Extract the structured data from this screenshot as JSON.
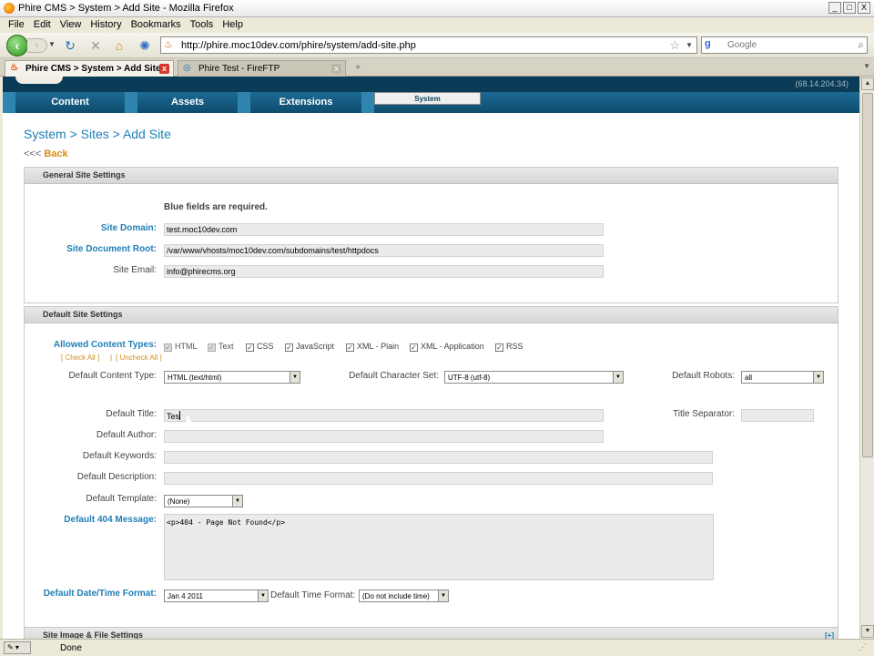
{
  "window": {
    "title": "Phire CMS > System > Add Site - Mozilla Firefox",
    "min": "_",
    "max": "□",
    "close": "X"
  },
  "menu": [
    "File",
    "Edit",
    "View",
    "History",
    "Bookmarks",
    "Tools",
    "Help"
  ],
  "toolbar": {
    "url": "http://phire.moc10dev.com/phire/system/add-site.php",
    "search_placeholder": "Google"
  },
  "tabs": [
    {
      "label": "Phire CMS > System > Add Site",
      "active": true
    },
    {
      "label": "Phire Test - FireFTP",
      "active": false
    }
  ],
  "site": {
    "header_meta": "(68.14.204.34)",
    "nav": [
      "Content",
      "Assets",
      "Extensions",
      "System"
    ]
  },
  "page": {
    "breadcrumb": "System > Sites > Add Site",
    "back_arrows": "<<<",
    "back_label": "Back"
  },
  "general": {
    "heading": "General Site Settings",
    "required_note": "Blue fields are required.",
    "site_domain_label": "Site Domain:",
    "site_domain_value": "test.moc10dev.com",
    "doc_root_label": "Site Document Root:",
    "doc_root_value": "/var/www/vhosts/moc10dev.com/subdomains/test/httpdocs",
    "email_label": "Site Email:",
    "email_value": "info@phirecms.org"
  },
  "defaults": {
    "heading": "Default Site Settings",
    "allowed_types_label": "Allowed Content Types:",
    "check_all": "[ Check All ]",
    "uncheck_all": "[ Uncheck All ]",
    "separator": "|",
    "content_types": [
      {
        "label": "HTML",
        "checked": true,
        "disabled": true
      },
      {
        "label": "Text",
        "checked": true,
        "disabled": true
      },
      {
        "label": "CSS",
        "checked": true,
        "disabled": false
      },
      {
        "label": "JavaScript",
        "checked": true,
        "disabled": false
      },
      {
        "label": "XML - Plain",
        "checked": true,
        "disabled": false
      },
      {
        "label": "XML - Application",
        "checked": true,
        "disabled": false
      },
      {
        "label": "RSS",
        "checked": true,
        "disabled": false
      }
    ],
    "content_type_label": "Default Content Type:",
    "content_type_value": "HTML (text/html)",
    "charset_label": "Default Character Set:",
    "charset_value": "UTF-8 (utf-8)",
    "robots_label": "Default Robots:",
    "robots_value": "all",
    "title_label": "Default Title:",
    "title_value": "Tes",
    "title_sep_label": "Title Separator:",
    "title_sep_value": "",
    "author_label": "Default Author:",
    "author_value": "",
    "keywords_label": "Default Keywords:",
    "keywords_value": "",
    "description_label": "Default Description:",
    "description_value": "",
    "template_label": "Default Template:",
    "template_value": "(None)",
    "msg404_label": "Default 404 Message:",
    "msg404_value": "<p>404 - Page Not Found</p>",
    "datetime_label": "Default Date/Time Format:",
    "date_value": "Jan 4 2011",
    "time_label": "Default Time Format:",
    "time_value": "(Do not include time)"
  },
  "next_section": {
    "heading": "Site Image & File Settings",
    "toggle": "[+]"
  },
  "status": {
    "text": "Done"
  }
}
